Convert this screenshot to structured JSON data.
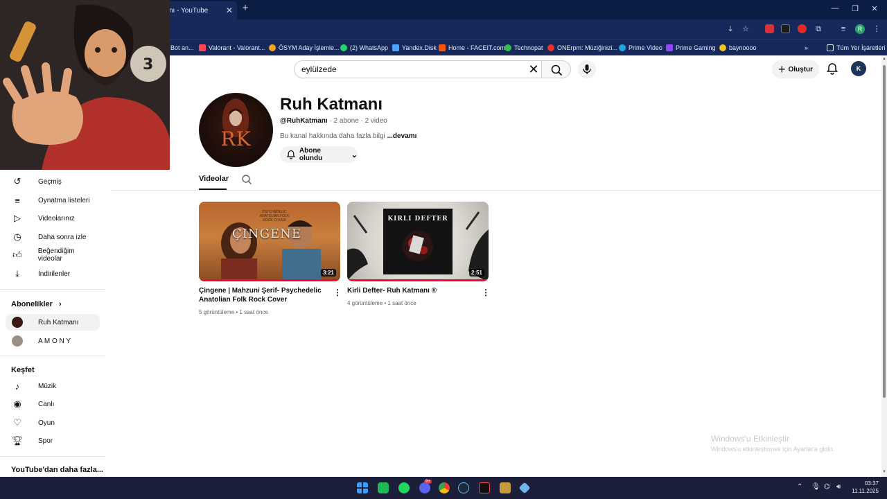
{
  "browser": {
    "tab_title": "nı - YouTube",
    "bookmarks": [
      {
        "label": "Bot an..."
      },
      {
        "label": "Valorant - Valorant..."
      },
      {
        "label": "ÖSYM Aday İşlemle..."
      },
      {
        "label": "(2) WhatsApp"
      },
      {
        "label": "Yandex.Disk"
      },
      {
        "label": "Home - FACEIT.com"
      },
      {
        "label": "Technopat"
      },
      {
        "label": "ONErpm: Müziğinizi..."
      },
      {
        "label": "Prime Video"
      },
      {
        "label": "Prime Gaming"
      },
      {
        "label": "baynoooo"
      }
    ],
    "all_bookmarks": "Tüm Yer İşaretleri",
    "profile_letter": "R"
  },
  "youtube": {
    "search": {
      "value": "eylülzede"
    },
    "create_label": "Oluştur",
    "channel": {
      "avatar_text": "RK",
      "name": "Ruh Katmanı",
      "handle": "@RuhKatmanı",
      "stats": "· 2 abone · 2 video",
      "description": "Bu kanal hakkında daha fazla bilgi",
      "more_label": "...devamı",
      "subscribe_label": "Abone olundu"
    },
    "tabs": [
      {
        "label": "Videolar"
      }
    ],
    "videos": [
      {
        "title": "Çingene | Mahzuni Şerif- Psychedelic Anatolian Folk Rock Cover",
        "duration": "3:21",
        "meta": "5 görüntüleme • 1 saat önce",
        "thumb_text": "ÇINGENE",
        "thumb_subtext": "PSYCHEDELIC ANATOLIAN FOLK ROCK COVER"
      },
      {
        "title": "Kirli Defter- Ruh Katmanı ®",
        "duration": "2:51",
        "meta": "4 görüntüleme • 1 saat önce",
        "thumb_text": "KIRLI DEFTER"
      }
    ],
    "sidebar": {
      "you_items": [
        {
          "label": "Geçmiş",
          "icon": "history-icon"
        },
        {
          "label": "Oynatma listeleri",
          "icon": "playlists-icon"
        },
        {
          "label": "Videolarınız",
          "icon": "your-videos-icon"
        },
        {
          "label": "Daha sonra izle",
          "icon": "watch-later-icon"
        },
        {
          "label": "Beğendiğim videolar",
          "icon": "liked-icon"
        },
        {
          "label": "İndirilenler",
          "icon": "download-icon"
        }
      ],
      "subscriptions_title": "Abonelikler",
      "subscriptions": [
        {
          "label": "Ruh Katmanı"
        },
        {
          "label": "A M O N Y"
        }
      ],
      "explore_title": "Keşfet",
      "explore_items": [
        {
          "label": "Müzik",
          "icon": "music-icon"
        },
        {
          "label": "Canlı",
          "icon": "live-icon"
        },
        {
          "label": "Oyun",
          "icon": "gaming-icon"
        },
        {
          "label": "Spor",
          "icon": "trophy-icon"
        }
      ],
      "more_title": "YouTube'dan daha fazla..."
    }
  },
  "watermark": {
    "title": "Windows'u Etkinleştir",
    "subtitle": "Windows'u etkinleştirmek için Ayarlar'a gidin."
  },
  "taskbar": {
    "time": "03:37",
    "date": "11.11.2025",
    "discord_badge": "9+"
  }
}
